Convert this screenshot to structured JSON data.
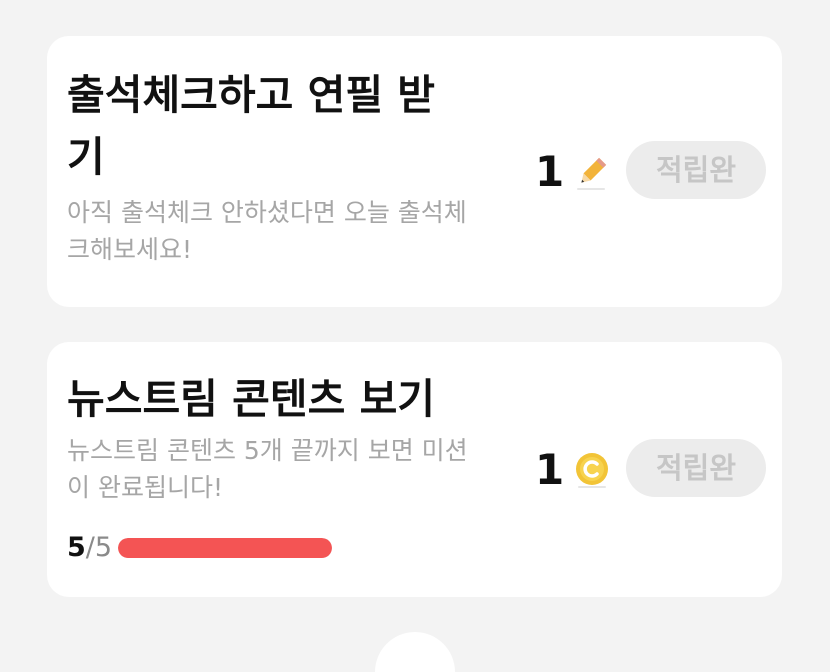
{
  "missions": [
    {
      "title": "출석체크하고 연필 받기",
      "description": "아직 출석체크 안하셨다면 오늘 출석체크해보세요!",
      "reward_count": "1",
      "reward_icon": "pencil-icon",
      "status_label": "적립완"
    },
    {
      "title": "뉴스트림 콘텐츠 보기",
      "description": "뉴스트림 콘텐츠 5개 끝까지 보면 미션이 완료됩니다!",
      "reward_count": "1",
      "reward_icon": "coin-icon",
      "status_label": "적립완",
      "progress": {
        "current": "5",
        "total": "/5",
        "fraction": 1.0
      }
    }
  ],
  "colors": {
    "progress_fill": "#f45454",
    "badge_bg": "#ececec",
    "badge_text": "#c6c6c6",
    "coin": "#f2c437",
    "pencil": "#f2b33a"
  }
}
